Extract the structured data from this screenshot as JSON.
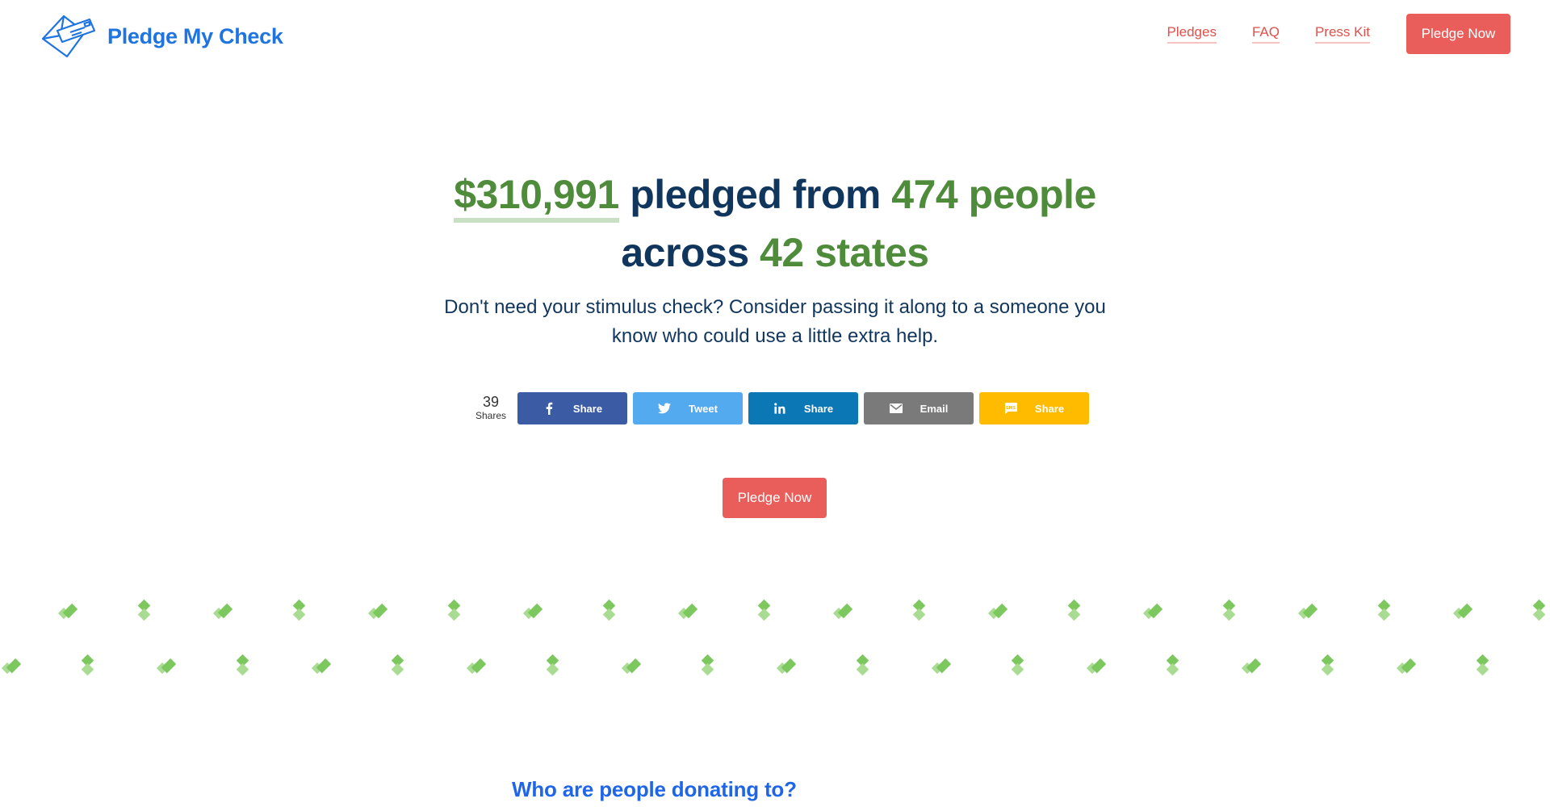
{
  "header": {
    "brand_name": "Pledge My Check",
    "nav": {
      "pledges": "Pledges",
      "faq": "FAQ",
      "press_kit": "Press Kit",
      "cta": "Pledge Now"
    }
  },
  "hero": {
    "amount": "$310,991",
    "text_pledged_from": "pledged from",
    "people_count": "474",
    "people_word": "people",
    "text_across": "across",
    "states_count": "42",
    "states_word": "states",
    "subtitle": "Don't need your stimulus check? Consider passing it along to a someone you know who could use a little extra help."
  },
  "share": {
    "count": "39",
    "count_label": "Shares",
    "buttons": {
      "facebook": {
        "label": "Share",
        "icon": "facebook-icon",
        "color": "#3b5ba5"
      },
      "twitter": {
        "label": "Tweet",
        "icon": "twitter-icon",
        "color": "#54aaee"
      },
      "linkedin": {
        "label": "Share",
        "icon": "linkedin-icon",
        "color": "#0b77b5"
      },
      "email": {
        "label": "Email",
        "icon": "email-icon",
        "color": "#7a7a7a"
      },
      "sms": {
        "label": "Share",
        "icon": "sms-icon",
        "color": "#ffbb00"
      }
    }
  },
  "cta": {
    "label": "Pledge Now"
  },
  "section": {
    "title": "Who are people donating to?"
  },
  "colors": {
    "brand_blue": "#1e74e0",
    "navy": "#11365e",
    "green": "#4e8b3a",
    "coral": "#e95e5a",
    "pattern_green": "#7cc75e"
  }
}
